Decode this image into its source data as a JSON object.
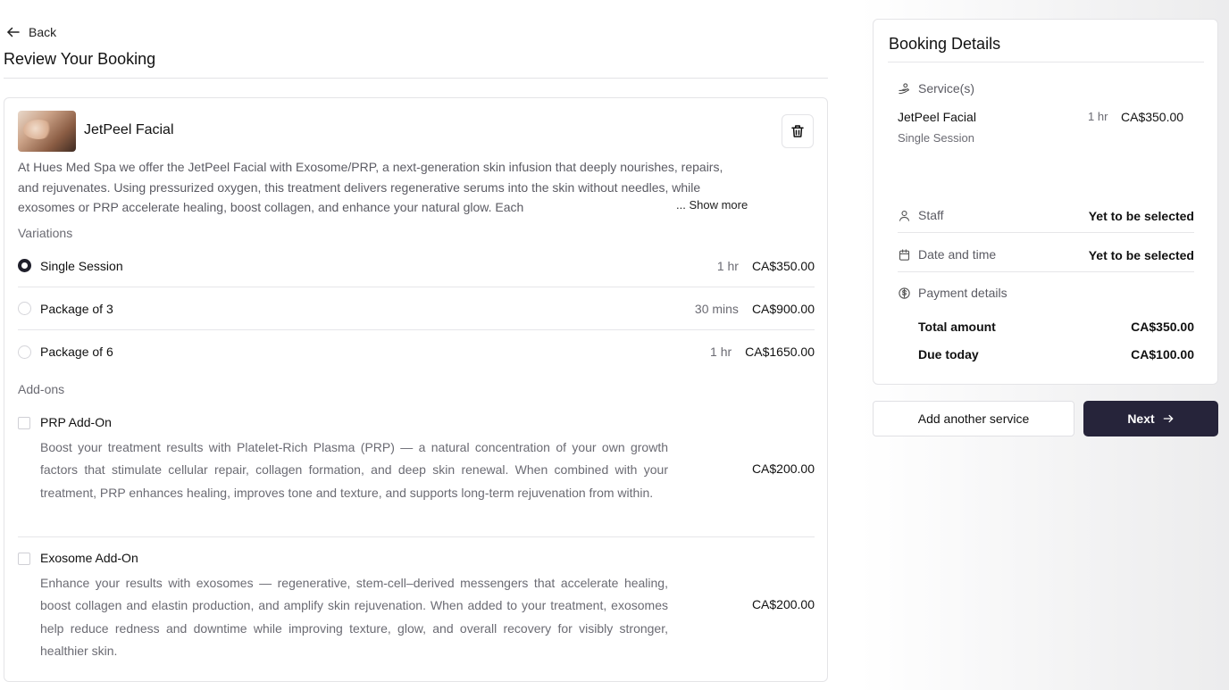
{
  "nav": {
    "back_label": "Back"
  },
  "page": {
    "title": "Review Your Booking"
  },
  "service": {
    "name": "JetPeel Facial",
    "description": "At Hues Med Spa we offer the JetPeel Facial with Exosome/PRP, a next-generation skin infusion that deeply nourishes, repairs, and rejuvenates. Using pressurized oxygen, this treatment delivers regenerative serums into the skin without needles, while exosomes or PRP accelerate healing, boost collagen, and enhance your natural glow. Each",
    "show_more_label": "... Show more",
    "variations_label": "Variations",
    "variations": [
      {
        "name": "Single Session",
        "duration": "1 hr",
        "price": "CA$350.00",
        "selected": true
      },
      {
        "name": "Package of 3",
        "duration": "30 mins",
        "price": "CA$900.00",
        "selected": false
      },
      {
        "name": "Package of 6",
        "duration": "1 hr",
        "price": "CA$1650.00",
        "selected": false
      }
    ],
    "addons_label": "Add-ons",
    "addons": [
      {
        "name": "PRP Add-On",
        "description": "Boost your treatment results with Platelet-Rich Plasma (PRP) — a natural concentration of your own growth factors that stimulate cellular repair, collagen formation, and deep skin renewal. When combined with your treatment, PRP enhances healing, improves tone and texture, and supports long-term rejuvenation from within.",
        "price": "CA$200.00",
        "checked": false
      },
      {
        "name": "Exosome Add-On",
        "description": "Enhance your results with exosomes — regenerative, stem-cell–derived messengers that accelerate healing, boost collagen and elastin production, and amplify skin rejuvenation. When added to your treatment, exosomes help reduce redness and downtime while improving texture, glow, and overall recovery for visibly stronger, healthier skin.",
        "price": "CA$200.00",
        "checked": false
      }
    ]
  },
  "booking_details": {
    "title": "Booking Details",
    "services_label": "Service(s)",
    "service_name": "JetPeel Facial",
    "service_variant": "Single Session",
    "service_duration": "1 hr",
    "service_price": "CA$350.00",
    "staff_label": "Staff",
    "staff_value": "Yet to be selected",
    "datetime_label": "Date and time",
    "datetime_value": "Yet to be selected",
    "payment_label": "Payment details",
    "total_label": "Total amount",
    "total_value": "CA$350.00",
    "due_label": "Due today",
    "due_value": "CA$100.00"
  },
  "actions": {
    "add_service_label": "Add another service",
    "next_label": "Next"
  },
  "colors": {
    "primary": "#26243a",
    "border": "#e4e4e7",
    "muted_text": "#6b6b73"
  }
}
